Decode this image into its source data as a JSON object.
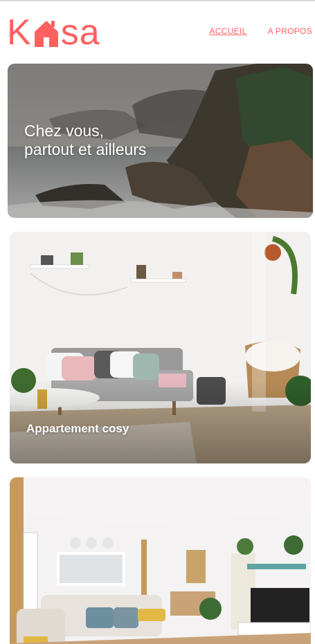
{
  "brand": {
    "logo_letters": [
      "K",
      "s",
      "a"
    ],
    "logo_icon": "house-icon",
    "color": "#ff6060"
  },
  "nav": {
    "items": [
      {
        "label": "ACCUEIL",
        "active": true
      },
      {
        "label": "A PROPOS",
        "active": false
      }
    ]
  },
  "hero": {
    "title_line1": "Chez vous,",
    "title_line2": "partout et ailleurs"
  },
  "listings": [
    {
      "title": "Appartement cosy"
    },
    {
      "title": ""
    }
  ]
}
